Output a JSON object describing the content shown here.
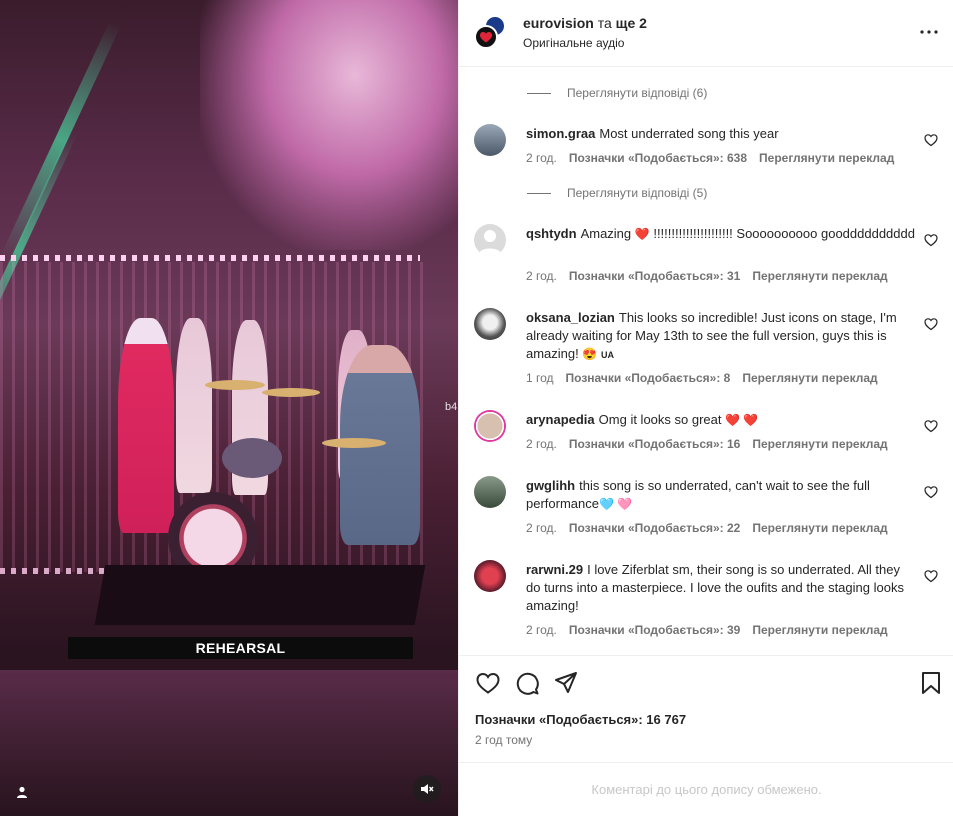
{
  "media": {
    "caption_overlay": "REHEARSAL",
    "watermark": "b4",
    "user_tag_icon": "user-icon",
    "mute_icon": "speaker-muted-icon"
  },
  "header": {
    "account": "eurovision",
    "connector": "та",
    "others": "ще 2",
    "audio": "Оригінальне аудіо",
    "more_icon": "more-horizontal-icon"
  },
  "comments": {
    "replies": [
      {
        "label": "Переглянути відповіді (6)"
      },
      {
        "label": "Переглянути відповіді (5)"
      }
    ],
    "items": [
      {
        "user": "simon.graa",
        "text": "Most underrated song this year",
        "emoji": "",
        "time": "2 год.",
        "likes": "Позначки «Подобається»: 638",
        "translate": "Переглянути переклад",
        "avatar_color": "#6a7a8a"
      },
      {
        "user": "qshtydn",
        "text_before": "Amazing ",
        "emoji": "❤️",
        "text_after": " !!!!!!!!!!!!!!!!!!!!!! Soooooooooo goodddddddddd",
        "time": "2 год.",
        "likes": "Позначки «Подобається»: 31",
        "translate": "Переглянути переклад",
        "avatar_color": "#c7c7c7"
      },
      {
        "user": "oksana_lozian",
        "text": "This looks so incredible! Just icons on stage, I'm already waiting for May 13th to see the full version, guys this is amazing!",
        "emoji": "😍",
        "flag": "UA",
        "time": "1 год",
        "likes": "Позначки «Подобається»: 8",
        "translate": "Переглянути переклад",
        "avatar_color": "#444444"
      },
      {
        "user": "arynapedia",
        "text": "Omg it looks so great",
        "emoji": "❤️ ❤️",
        "time": "2 год.",
        "likes": "Позначки «Подобається»: 16",
        "translate": "Переглянути переклад",
        "avatar_color": "#b89a8a"
      },
      {
        "user": "gwglihh",
        "text": "this song is so underrated, can't wait to see the full performance",
        "emoji": "🩵 🩷",
        "time": "2 год.",
        "likes": "Позначки «Подобається»: 22",
        "translate": "Переглянути переклад",
        "avatar_color": "#5a6a5a"
      },
      {
        "user": "rarwni.29",
        "text": "I love Ziferblat sm, their song is so underrated. All they do turns into a masterpiece. I love the oufits and the staging looks amazing!",
        "emoji": "",
        "time": "2 год.",
        "likes": "Позначки «Подобається»: 39",
        "translate": "Переглянути переклад",
        "avatar_color": "#9a2a3a"
      }
    ]
  },
  "actions": {
    "like_icon": "heart-icon",
    "comment_icon": "comment-icon",
    "share_icon": "share-icon",
    "save_icon": "bookmark-icon",
    "likes_text": "Позначки «Подобається»: 16 767",
    "time_ago": "2 год тому"
  },
  "footer": {
    "limited": "Коментарі до цього допису обмежено."
  }
}
